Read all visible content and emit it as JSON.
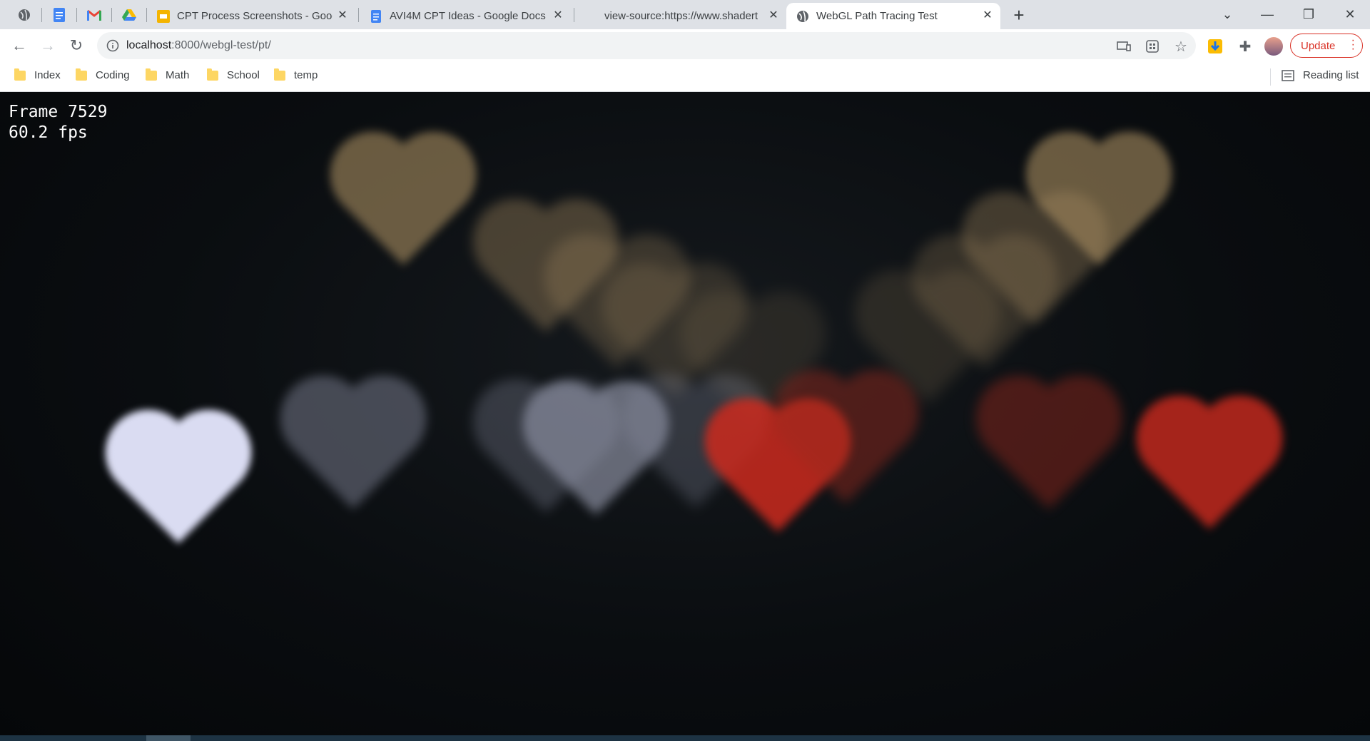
{
  "browser": {
    "tabs": [
      {
        "title": "CPT Process Screenshots - Googl",
        "icon": "slides-icon"
      },
      {
        "title": "AVI4M CPT Ideas - Google Docs",
        "icon": "docs-icon"
      },
      {
        "title": "view-source:https://www.shadert",
        "icon": "none"
      },
      {
        "title": "WebGL Path Tracing Test",
        "icon": "globe-icon",
        "active": true
      }
    ],
    "pinned_tabs": [
      "globe-icon",
      "docs-icon",
      "gmail-icon",
      "drive-icon"
    ],
    "new_tab_label": "+",
    "url_host": "localhost",
    "url_path": ":8000/webgl-test/pt/",
    "update_label": "Update"
  },
  "bookmarks": [
    {
      "label": "Index"
    },
    {
      "label": "Coding"
    },
    {
      "label": "Math"
    },
    {
      "label": "School"
    },
    {
      "label": "temp"
    }
  ],
  "reading_list_label": "Reading list",
  "hud": {
    "frame": "Frame 7529",
    "fps": "60.2 fps"
  },
  "colors": {
    "accent_update": "#d93025",
    "heart_gold": "#b89a68",
    "heart_white": "#e6e8ff",
    "heart_red": "#cc2a1e"
  }
}
